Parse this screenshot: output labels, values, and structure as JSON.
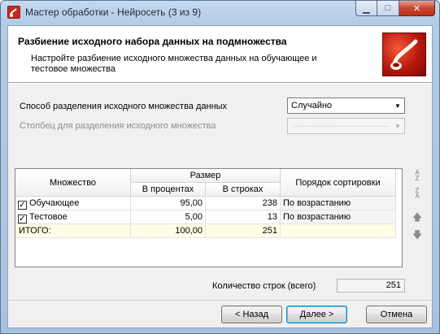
{
  "window": {
    "title": "Мастер обработки - Нейросеть (3 из 9)",
    "icon": "pipe-logo-icon",
    "controls": {
      "minimize": "▁",
      "maximize": "□",
      "close": "✕"
    }
  },
  "header": {
    "title": "Разбиение исходного набора данных на подмножества",
    "description": "Настройте разбиение исходного множества данных на обучающее и тестовое множества"
  },
  "split": {
    "method_label": "Способ разделения исходного множества данных",
    "method_value": "Случайно",
    "column_label": "Столбец для разделения исходного множества",
    "column_value": ""
  },
  "grid": {
    "headers": {
      "set": "Множество",
      "size": "Размер",
      "percent": "В процентах",
      "rows": "В строках",
      "sort": "Порядок сортировки"
    },
    "rows": [
      {
        "checked": true,
        "name": "Обучающее",
        "percent": "95,00",
        "rows": "238",
        "sort": "По возрастанию"
      },
      {
        "checked": true,
        "name": "Тестовое",
        "percent": "5,00",
        "rows": "13",
        "sort": "По возрастанию"
      }
    ],
    "total": {
      "name": "ИТОГО:",
      "percent": "100,00",
      "rows": "251",
      "sort": ""
    }
  },
  "side_tools": [
    "sort-ascending-icon",
    "sort-descending-icon",
    "move-up-icon",
    "move-down-icon"
  ],
  "count": {
    "label": "Количество строк (всего)",
    "value": "251"
  },
  "buttons": {
    "back": "< Назад",
    "next": "Далее >",
    "cancel": "Отмена"
  },
  "colors": {
    "total_row": "#fffde6",
    "close_button": "#c9452e",
    "logo": "#b8180e"
  }
}
